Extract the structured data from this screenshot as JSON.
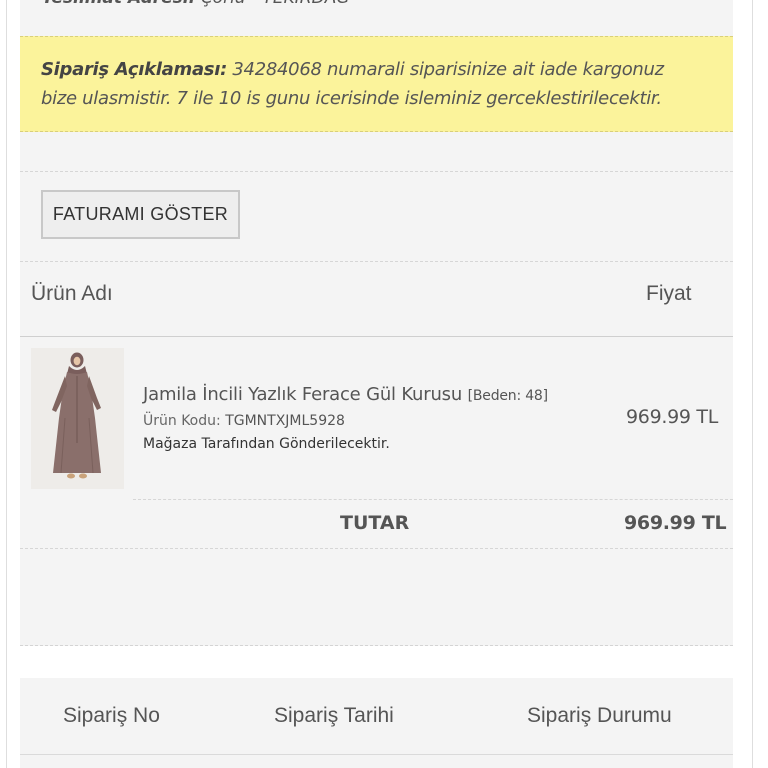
{
  "order_detail": {
    "delivery_address_label": "Teslimat Adresi:",
    "delivery_address_value": "Çorlu - TEKİRDAĞ",
    "note_label": "Sipariş Açıklaması:",
    "note_text": "34284068 numarali siparisinize ait iade kargonuz bize ulasmistir. 7 ile 10 is gunu icerisinde isleminiz gerceklestirilecektir.",
    "invoice_button_label": "FATURAMI GÖSTER",
    "table": {
      "col_product": "Ürün Adı",
      "col_price": "Fiyat"
    },
    "product": {
      "name": "Jamila İncili Yazlık Ferace Gül Kurusu",
      "size": "[Beden: 48]",
      "code_label": "Ürün Kodu:",
      "code_value": "TGMNTXJML5928",
      "shipping_note": "Mağaza Tarafından Gönderilecektir.",
      "price": "969.99 TL"
    },
    "total_label": "TUTAR",
    "total_value": "969.99 TL"
  },
  "orders_table": {
    "col_order_no": "Sipariş No",
    "col_order_date": "Sipariş Tarihi",
    "col_order_status": "Sipariş Durumu"
  },
  "colors": {
    "note_bg": "#fbf39b",
    "card_bg": "#f4f4f4",
    "product_dress": "#8a6f6b"
  },
  "icons": {
    "product_image": "dress-photo"
  }
}
